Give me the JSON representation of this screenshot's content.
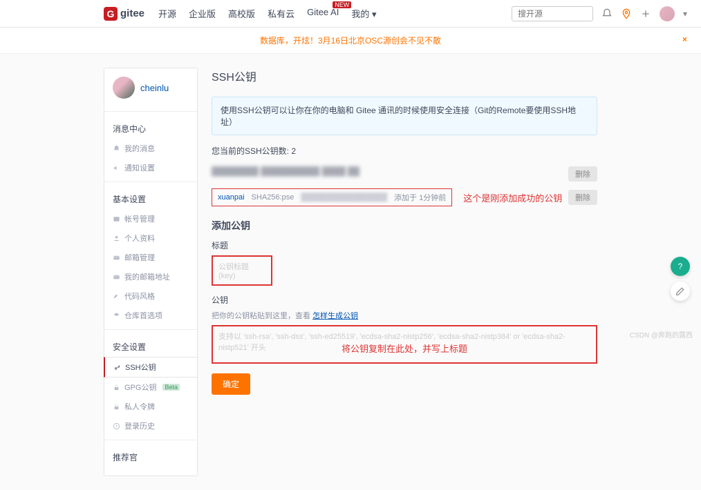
{
  "nav": {
    "logo_text": "gitee",
    "items": [
      "开源",
      "企业版",
      "高校版",
      "私有云",
      "Gitee AI",
      "我的"
    ],
    "ai_badge": "NEW",
    "search_placeholder": "搜开源"
  },
  "banner": {
    "text": "数据库，开炫！3月16日北京OSC源创会不见不散"
  },
  "user": {
    "name": "cheinlu"
  },
  "sidebar": {
    "s1_title": "消息中心",
    "s1": [
      {
        "icon": "bell",
        "label": "我的消息"
      },
      {
        "icon": "megaphone",
        "label": "通知设置"
      }
    ],
    "s2_title": "基本设置",
    "s2": [
      {
        "icon": "id",
        "label": "帐号管理"
      },
      {
        "icon": "person",
        "label": "个人资料"
      },
      {
        "icon": "mail",
        "label": "邮箱管理"
      },
      {
        "icon": "mail",
        "label": "我的邮箱地址"
      },
      {
        "icon": "wrench",
        "label": "代码风格"
      },
      {
        "icon": "layer",
        "label": "仓库首选项"
      }
    ],
    "s3_title": "安全设置",
    "s3": [
      {
        "icon": "key",
        "label": "SSH公钥",
        "active": true
      },
      {
        "icon": "lock",
        "label": "GPG公钥",
        "badge": "Beta"
      },
      {
        "icon": "lock",
        "label": "私人令牌"
      },
      {
        "icon": "clock",
        "label": "登录历史"
      }
    ],
    "s4_title": "推荐官"
  },
  "main": {
    "heading": "SSH公钥",
    "info": "使用SSH公钥可以让你在你的电脑和 Gitee 通讯的时候使用安全连接（Git的Remote要使用SSH地址）",
    "count_text": "您当前的SSH公钥数: 2",
    "key2": {
      "name": "xuanpai",
      "fp_prefix": "SHA256:pse",
      "time": "添加于 1分钟前"
    },
    "annotation1": "这个是刚添加成功的公钥",
    "delete_label": "删除",
    "add_title": "添加公钥",
    "title_label": "标题",
    "title_placeholder": "公钥标题(key)",
    "key_label": "公钥",
    "helper_text": "把你的公钥粘贴到这里，查看 ",
    "helper_link": "怎样生成公钥",
    "key_placeholder": "支持以 'ssh-rsa', 'ssh-dss', 'ssh-ed25519', 'ecdsa-sha2-nistp256', 'ecdsa-sha2-nistp384' or 'ecdsa-sha2-nistp521' 开头",
    "annotation2": "将公钥复制在此处，并写上标题",
    "submit": "确定"
  },
  "float": {
    "q": "?"
  },
  "watermark": "CSDN @奔跑的露西"
}
